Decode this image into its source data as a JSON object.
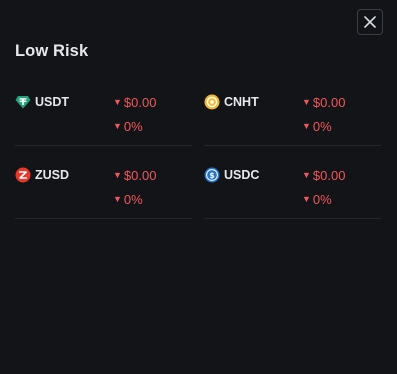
{
  "panel": {
    "title": "Low Risk",
    "close_icon": "close-icon"
  },
  "coins": [
    {
      "name": "USDT",
      "icon": "tether-icon",
      "price": "$0.00",
      "change": "0%",
      "direction": "down"
    },
    {
      "name": "CNHT",
      "icon": "cnht-coin-icon",
      "price": "$0.00",
      "change": "0%",
      "direction": "down"
    },
    {
      "name": "ZUSD",
      "icon": "zusd-coin-icon",
      "price": "$0.00",
      "change": "0%",
      "direction": "down"
    },
    {
      "name": "USDC",
      "icon": "usdc-coin-icon",
      "price": "$0.00",
      "change": "0%",
      "direction": "down"
    }
  ],
  "colors": {
    "background": "#121417",
    "negative": "#f1575b",
    "tether": "#26a17b",
    "cnht": "#f3ba2f",
    "zusd": "#e8372c",
    "usdc": "#2775ca"
  }
}
